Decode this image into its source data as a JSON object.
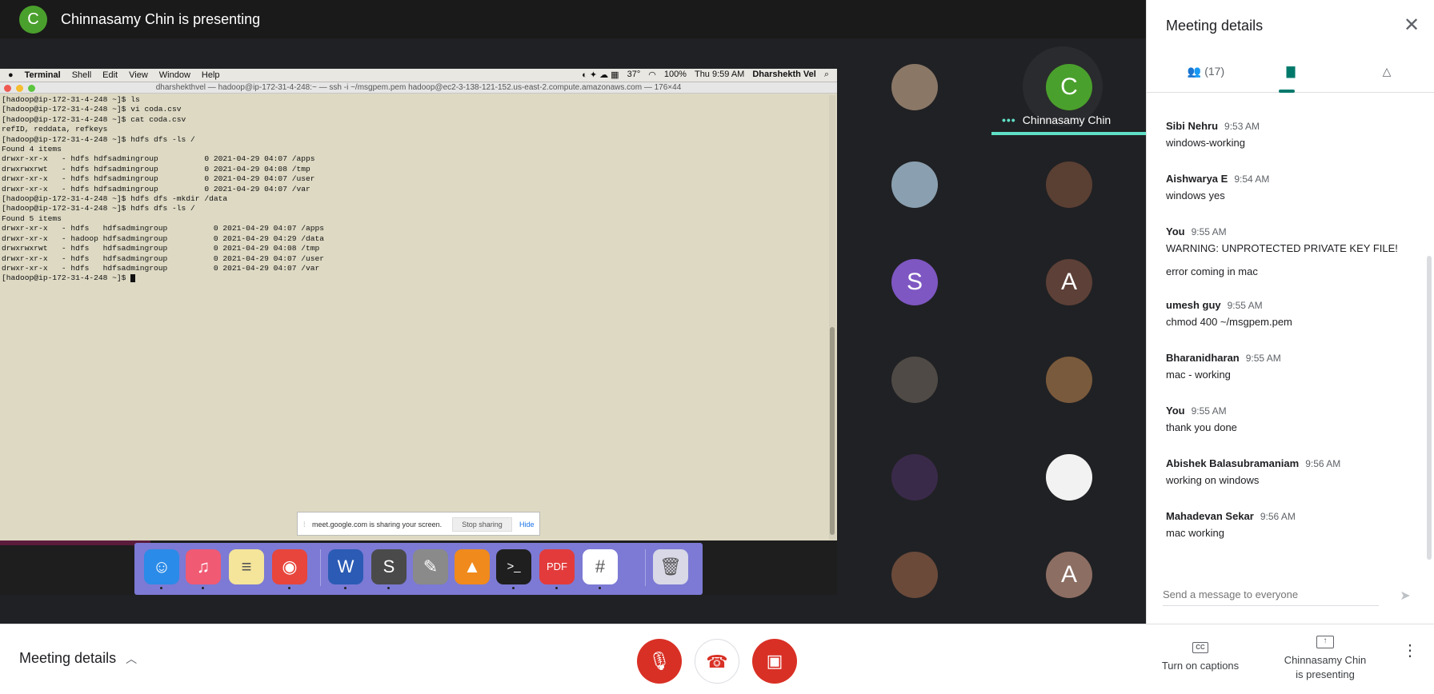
{
  "header": {
    "avatar_letter": "C",
    "presenting_text": "Chinnasamy Chin is presenting"
  },
  "shared_screen": {
    "menubar": {
      "apple": "",
      "items": [
        "Terminal",
        "Shell",
        "Edit",
        "View",
        "Window",
        "Help"
      ],
      "battery": "100%",
      "temp": "37°",
      "clock": "Thu 9:59 AM",
      "user": "Dharshekth Vel"
    },
    "terminal_title": "dharshekthvel — hadoop@ip-172-31-4-248:~ — ssh -i ~/msgpem.pem hadoop@ec2-3-138-121-152.us-east-2.compute.amazonaws.com — 176×44",
    "terminal_lines": [
      "[hadoop@ip-172-31-4-248 ~]$ ls",
      "[hadoop@ip-172-31-4-248 ~]$ vi coda.csv",
      "[hadoop@ip-172-31-4-248 ~]$ cat coda.csv",
      "refID, reddata, refkeys",
      "[hadoop@ip-172-31-4-248 ~]$ hdfs dfs -ls /",
      "Found 4 items",
      "drwxr-xr-x   - hdfs hdfsadmingroup          0 2021-04-29 04:07 /apps",
      "drwxrwxrwt   - hdfs hdfsadmingroup          0 2021-04-29 04:08 /tmp",
      "drwxr-xr-x   - hdfs hdfsadmingroup          0 2021-04-29 04:07 /user",
      "drwxr-xr-x   - hdfs hdfsadmingroup          0 2021-04-29 04:07 /var",
      "[hadoop@ip-172-31-4-248 ~]$ hdfs dfs -mkdir /data",
      "[hadoop@ip-172-31-4-248 ~]$ hdfs dfs -ls /",
      "Found 5 items",
      "drwxr-xr-x   - hdfs   hdfsadmingroup          0 2021-04-29 04:07 /apps",
      "drwxr-xr-x   - hadoop hdfsadmingroup          0 2021-04-29 04:29 /data",
      "drwxrwxrwt   - hdfs   hdfsadmingroup          0 2021-04-29 04:08 /tmp",
      "drwxr-xr-x   - hdfs   hdfsadmingroup          0 2021-04-29 04:07 /user",
      "drwxr-xr-x   - hdfs   hdfsadmingroup          0 2021-04-29 04:07 /var",
      "[hadoop@ip-172-31-4-248 ~]$ "
    ],
    "share_banner": {
      "message": "meet.google.com is sharing your screen.",
      "stop_label": "Stop sharing",
      "hide_label": "Hide"
    },
    "dock_apps": [
      {
        "name": "finder-icon",
        "glyph": "☺",
        "color": "#2b8be8"
      },
      {
        "name": "music-icon",
        "glyph": "♫",
        "color": "#f05a73"
      },
      {
        "name": "notes-icon",
        "glyph": "≡",
        "color": "#f4e59a"
      },
      {
        "name": "chrome-icon",
        "glyph": "◉",
        "color": "#e8453c"
      },
      {
        "name": "word-icon",
        "glyph": "W",
        "color": "#2b5bb5"
      },
      {
        "name": "sublime-icon",
        "glyph": "S",
        "color": "#4a4a4a"
      },
      {
        "name": "color-picker-icon",
        "glyph": "✎",
        "color": "#8a8a8a"
      },
      {
        "name": "vlc-icon",
        "glyph": "▲",
        "color": "#f08a1c"
      },
      {
        "name": "terminal-icon",
        "glyph": ">_",
        "color": "#1f1f1f"
      },
      {
        "name": "pdf-icon",
        "glyph": "PDF",
        "color": "#e33b3b"
      },
      {
        "name": "slack-icon",
        "glyph": "#",
        "color": "#ffffff"
      },
      {
        "name": "trash-icon",
        "glyph": "🗑",
        "color": "#d8d8e6"
      }
    ]
  },
  "participants": {
    "tiles": [
      {
        "type": "photo",
        "letter": "",
        "color": "#8a7766"
      },
      {
        "type": "letter",
        "letter": "C",
        "color": "#4aa02c"
      },
      {
        "type": "photo",
        "letter": "",
        "color": "#8aa0b0"
      },
      {
        "type": "photo",
        "letter": "",
        "color": "#5a3f33"
      },
      {
        "type": "letter",
        "letter": "S",
        "color": "#7e57c2"
      },
      {
        "type": "letter",
        "letter": "A",
        "color": "#5d4037"
      },
      {
        "type": "photo",
        "letter": "",
        "color": "#4f4a45"
      },
      {
        "type": "photo",
        "letter": "",
        "color": "#7a5a3c"
      },
      {
        "type": "photo",
        "letter": "",
        "color": "#3a2a4a"
      },
      {
        "type": "photo",
        "letter": "",
        "color": "#f2f2f2"
      },
      {
        "type": "photo",
        "letter": "",
        "color": "#6b4a3a"
      },
      {
        "type": "letter",
        "letter": "A",
        "color": "#8d6e63"
      }
    ],
    "presenter_label": "Chinnasamy Chin",
    "presenter_dots": "•••"
  },
  "panel": {
    "title": "Meeting details",
    "people_count": "(17)",
    "messages": [
      {
        "sender": "Sibi Nehru",
        "time": "9:53 AM",
        "text": "windows-working",
        "text2": ""
      },
      {
        "sender": "Aishwarya E",
        "time": "9:54 AM",
        "text": "windows yes",
        "text2": ""
      },
      {
        "sender": "You",
        "time": "9:55 AM",
        "text": " WARNING: UNPROTECTED PRIVATE KEY FILE!",
        "text2": "error coming in mac"
      },
      {
        "sender": "umesh guy",
        "time": "9:55 AM",
        "text": "chmod 400 ~/msgpem.pem",
        "text2": ""
      },
      {
        "sender": "Bharanidharan",
        "time": "9:55 AM",
        "text": "mac - working",
        "text2": ""
      },
      {
        "sender": "You",
        "time": "9:55 AM",
        "text": "thank you done",
        "text2": ""
      },
      {
        "sender": "Abishek Balasubramaniam",
        "time": "9:56 AM",
        "text": "working on windows",
        "text2": ""
      },
      {
        "sender": "Mahadevan Sekar",
        "time": "9:56 AM",
        "text": "mac working",
        "text2": ""
      }
    ],
    "input_placeholder": "Send a message to everyone"
  },
  "bottom_bar": {
    "meeting_details_label": "Meeting details",
    "captions_label": "Turn on captions",
    "present_label_line1": "Chinnasamy Chin",
    "present_label_line2": "is presenting"
  },
  "colors": {
    "accent": "#00796b",
    "danger": "#d93025",
    "presenting": "#5fdfc5"
  }
}
